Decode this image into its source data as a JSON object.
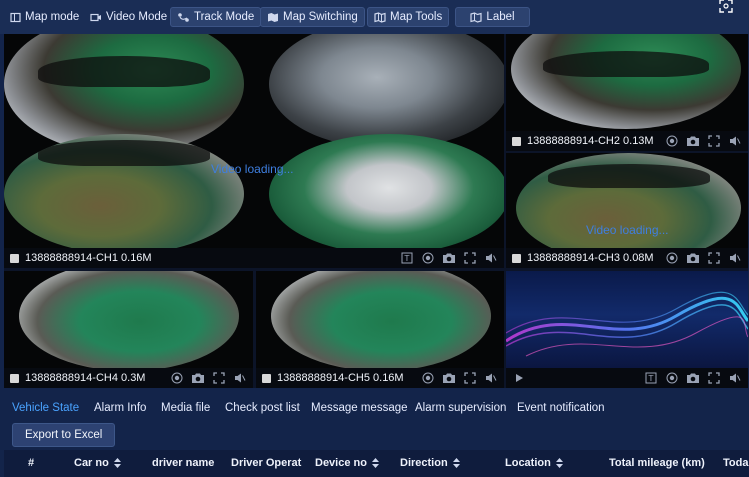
{
  "toolbar": {
    "buttons": [
      {
        "label": "Map mode",
        "icon": "map-mode-icon"
      },
      {
        "label": "Video Mode",
        "icon": "video-icon"
      },
      {
        "label": "Track Mode",
        "icon": "track-icon"
      },
      {
        "label": "Map Switching",
        "icon": "map-switch-icon"
      },
      {
        "label": "Map Tools",
        "icon": "map-tools-icon"
      },
      {
        "label": "Label",
        "icon": "label-icon"
      }
    ]
  },
  "video": {
    "loading_text": "Video loading...",
    "loading_text_ch3": "Video loading...",
    "channels": [
      {
        "label": "13888888914-CH1 0.16M"
      },
      {
        "label": "13888888914-CH2 0.13M"
      },
      {
        "label": "13888888914-CH3 0.08M"
      },
      {
        "label": "13888888914-CH4 0.3M"
      },
      {
        "label": "13888888914-CH5 0.16M"
      }
    ]
  },
  "tabs": [
    {
      "label": "Vehicle State",
      "active": true
    },
    {
      "label": "Alarm Info"
    },
    {
      "label": "Media file"
    },
    {
      "label": "Check post list"
    },
    {
      "label": "Message message"
    },
    {
      "label": "Alarm supervision"
    },
    {
      "label": "Event notification"
    }
  ],
  "export_label": "Export to Excel",
  "table": {
    "columns": [
      "#",
      "Car no",
      "driver name",
      "Driver Operat",
      "Device no",
      "Direction",
      "Location",
      "Total mileage (km)",
      "Toda"
    ]
  },
  "colors": {
    "accent": "#4aa3ff",
    "background": "#13244a",
    "toolbar": "#1a2d55"
  }
}
